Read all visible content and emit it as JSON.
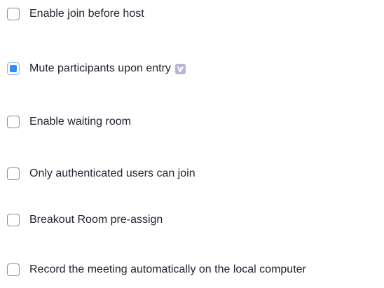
{
  "options": [
    {
      "label": "Enable join before host",
      "checked": false
    },
    {
      "label": "Mute participants upon entry",
      "checked": true,
      "badge_icon": "locked-setting-icon"
    },
    {
      "label": "Enable waiting room",
      "checked": false
    },
    {
      "label": "Only authenticated users can join",
      "checked": false
    },
    {
      "label": "Breakout Room pre-assign",
      "checked": false
    },
    {
      "label": "Record the meeting automatically on the local computer",
      "checked": false
    }
  ],
  "colors": {
    "checkbox_border": "#8e8e93",
    "checkbox_checked_fill": "#2d8cff",
    "text": "#232333",
    "badge": "#b9b3d9"
  }
}
